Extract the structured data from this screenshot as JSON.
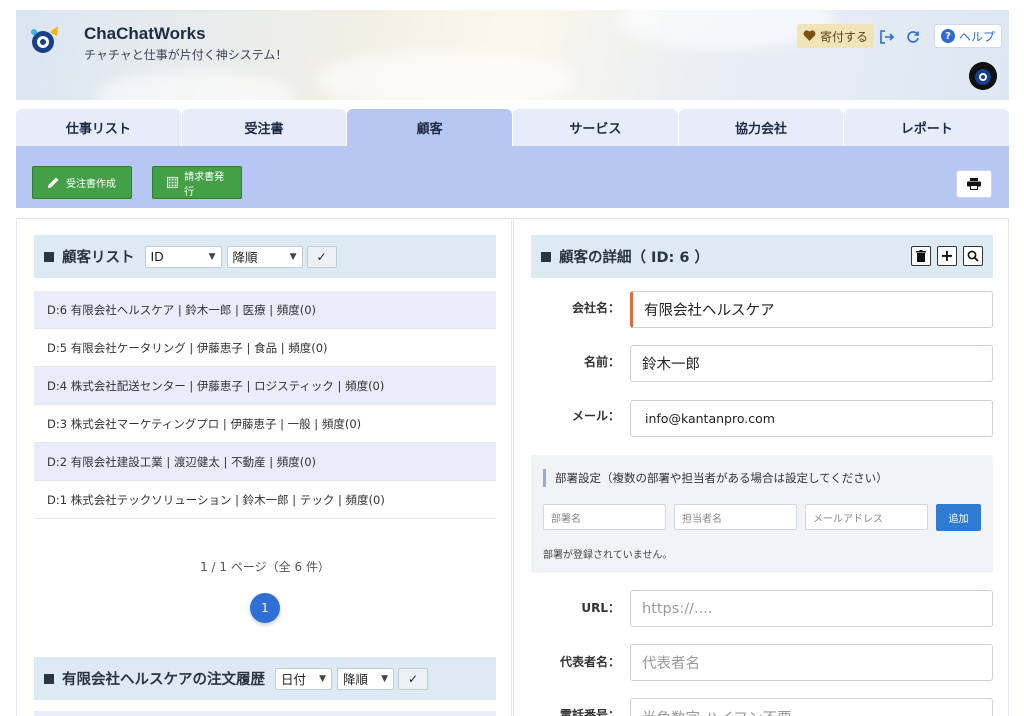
{
  "header": {
    "app_title": "ChaChatWorks",
    "app_subtitle": "チャチャと仕事が片付く神システム！",
    "donate_label": "寄付する",
    "help_label": "ヘルプ"
  },
  "tabs": [
    {
      "label": "仕事リスト",
      "active": false
    },
    {
      "label": "受注書",
      "active": false
    },
    {
      "label": "顧客",
      "active": true
    },
    {
      "label": "サービス",
      "active": false
    },
    {
      "label": "協力会社",
      "active": false
    },
    {
      "label": "レポート",
      "active": false
    }
  ],
  "toolbar": {
    "create_order_label": "受注書作成",
    "issue_invoice_label": "請求書発行"
  },
  "customer_list": {
    "title": "顧客リスト",
    "sort_field": "ID",
    "sort_order": "降順",
    "rows": [
      "D:6 有限会社ヘルスケア | 鈴木一郎 | 医療 | 頻度(0)",
      "D:5 有限会社ケータリング | 伊藤恵子 | 食品 | 頻度(0)",
      "D:4 株式会社配送センター | 伊藤恵子 | ロジスティック | 頻度(0)",
      "D:3 株式会社マーケティングプロ | 伊藤恵子 | 一般 | 頻度(0)",
      "D:2 有限会社建設工業 | 渡辺健太 | 不動産 | 頻度(0)",
      "D:1 株式会社テックソリューション | 鈴木一郎 | テック | 頻度(0)"
    ],
    "pager_text": "1 / 1 ページ（全 6 件）",
    "current_page": "1"
  },
  "order_history": {
    "title": "有限会社ヘルスケアの注文履歴",
    "sort_field": "日付",
    "sort_order": "降順"
  },
  "customer_detail": {
    "title": "顧客の詳細（ ID: 6 ）",
    "company_label": "会社名：",
    "company_value": "有限会社ヘルスケア",
    "name_label": "名前：",
    "name_value": "鈴木一郎",
    "email_label": "メール：",
    "email_value": "info@kantanpro.com",
    "dept_title": "部署設定（複数の部署や担当者がある場合は設定してください）",
    "dept_name_ph": "部署名",
    "dept_person_ph": "担当者名",
    "dept_email_ph": "メールアドレス",
    "dept_add_label": "追加",
    "dept_empty": "部署が登録されていません。",
    "url_label": "URL：",
    "url_ph": "https://....",
    "rep_label": "代表者名：",
    "rep_ph": "代表者名",
    "phone_label": "電話番号：",
    "phone_ph": "半角数字 ハイフン不要"
  },
  "colors": {
    "tab_active": "#b6c7f3",
    "tab_inactive": "#e7ecfb",
    "action_green": "#43a047",
    "primary_blue": "#2f6fd6",
    "section_header": "#dceaf3"
  }
}
